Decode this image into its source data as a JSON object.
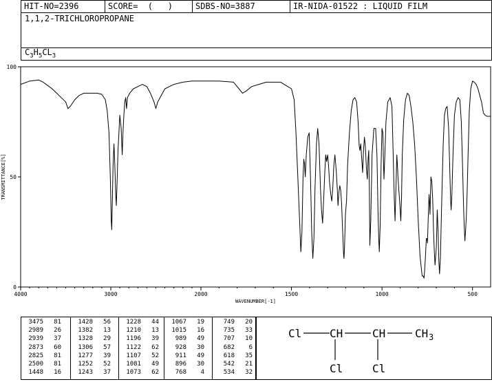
{
  "header": {
    "hit_no": "HIT-NO=2396",
    "score": "SCORE=  (   )",
    "sdbs_no": "SDBS-NO=3887",
    "ir_info": "IR-NIDA-01522 : LIQUID FILM"
  },
  "compound": {
    "name": "1,1,2-TRICHLOROPROPANE",
    "formula_parts": [
      "C",
      "3",
      "H",
      "5",
      "CL",
      "3"
    ]
  },
  "structure": {
    "atoms": [
      "Cl",
      "CH",
      "CH",
      "CH",
      "3",
      "Cl",
      "Cl"
    ]
  },
  "peak_table": {
    "columns": [
      [
        [
          "3475",
          "81"
        ],
        [
          "2989",
          "26"
        ],
        [
          "2939",
          "37"
        ],
        [
          "2873",
          "60"
        ],
        [
          "2825",
          "81"
        ],
        [
          "2500",
          "81"
        ],
        [
          "1448",
          "16"
        ]
      ],
      [
        [
          "1428",
          "56"
        ],
        [
          "1382",
          "13"
        ],
        [
          "1328",
          "29"
        ],
        [
          "1306",
          "57"
        ],
        [
          "1277",
          "39"
        ],
        [
          "1252",
          "52"
        ],
        [
          "1243",
          "37"
        ]
      ],
      [
        [
          "1228",
          "44"
        ],
        [
          "1210",
          "13"
        ],
        [
          "1196",
          "39"
        ],
        [
          "1122",
          "62"
        ],
        [
          "1107",
          "52"
        ],
        [
          "1081",
          "49"
        ],
        [
          "1073",
          "62"
        ]
      ],
      [
        [
          "1067",
          "19"
        ],
        [
          "1015",
          "16"
        ],
        [
          "989",
          "49"
        ],
        [
          "928",
          "30"
        ],
        [
          "911",
          "49"
        ],
        [
          "896",
          "30"
        ],
        [
          "768",
          "4"
        ]
      ],
      [
        [
          "749",
          "20"
        ],
        [
          "735",
          "33"
        ],
        [
          "707",
          "10"
        ],
        [
          "682",
          "6"
        ],
        [
          "618",
          "35"
        ],
        [
          "542",
          "21"
        ],
        [
          "534",
          "32"
        ]
      ]
    ]
  },
  "chart_data": {
    "type": "line",
    "title": "",
    "xlabel": "WAVENUMBER[-1]",
    "ylabel": "TRANSMITTANCE[%]",
    "xlim": [
      4000,
      400
    ],
    "ylim": [
      0,
      100
    ],
    "x_ticks": [
      4000,
      3000,
      2000,
      1500,
      1000,
      500
    ],
    "x_tick_labels": [
      "4000",
      "3000",
      "2000",
      "1500",
      "1000",
      "500"
    ],
    "y_ticks": [
      0,
      50,
      100
    ],
    "y_tick_labels": [
      "0",
      "50",
      "100"
    ],
    "grid": false,
    "series": [
      {
        "color": "#000000",
        "points": [
          [
            4000,
            92
          ],
          [
            3900,
            93.5
          ],
          [
            3800,
            94
          ],
          [
            3750,
            93
          ],
          [
            3700,
            91.5
          ],
          [
            3650,
            90
          ],
          [
            3600,
            88
          ],
          [
            3550,
            86
          ],
          [
            3500,
            84
          ],
          [
            3475,
            81
          ],
          [
            3450,
            82
          ],
          [
            3400,
            85
          ],
          [
            3350,
            87
          ],
          [
            3300,
            88
          ],
          [
            3250,
            88
          ],
          [
            3200,
            88
          ],
          [
            3150,
            88
          ],
          [
            3100,
            87.5
          ],
          [
            3060,
            85
          ],
          [
            3040,
            80
          ],
          [
            3020,
            70
          ],
          [
            3005,
            50
          ],
          [
            2995,
            30
          ],
          [
            2989,
            26
          ],
          [
            2985,
            35
          ],
          [
            2975,
            55
          ],
          [
            2965,
            65
          ],
          [
            2955,
            55
          ],
          [
            2945,
            42
          ],
          [
            2939,
            37
          ],
          [
            2932,
            45
          ],
          [
            2920,
            62
          ],
          [
            2910,
            70
          ],
          [
            2900,
            78
          ],
          [
            2885,
            72
          ],
          [
            2873,
            60
          ],
          [
            2865,
            70
          ],
          [
            2855,
            78
          ],
          [
            2845,
            84
          ],
          [
            2835,
            86
          ],
          [
            2825,
            81
          ],
          [
            2815,
            86
          ],
          [
            2790,
            88
          ],
          [
            2750,
            90
          ],
          [
            2700,
            91
          ],
          [
            2650,
            92
          ],
          [
            2600,
            91
          ],
          [
            2560,
            88
          ],
          [
            2520,
            84
          ],
          [
            2500,
            81
          ],
          [
            2480,
            84
          ],
          [
            2440,
            87
          ],
          [
            2400,
            90
          ],
          [
            2300,
            92
          ],
          [
            2200,
            93
          ],
          [
            2100,
            93.5
          ],
          [
            2000,
            93.5
          ],
          [
            1900,
            93.5
          ],
          [
            1820,
            93
          ],
          [
            1790,
            90
          ],
          [
            1770,
            88
          ],
          [
            1750,
            89
          ],
          [
            1720,
            91
          ],
          [
            1680,
            92
          ],
          [
            1640,
            93
          ],
          [
            1600,
            93
          ],
          [
            1560,
            93
          ],
          [
            1520,
            91
          ],
          [
            1500,
            90
          ],
          [
            1485,
            85
          ],
          [
            1475,
            70
          ],
          [
            1465,
            50
          ],
          [
            1455,
            30
          ],
          [
            1448,
            16
          ],
          [
            1442,
            25
          ],
          [
            1436,
            50
          ],
          [
            1432,
            58
          ],
          [
            1428,
            56
          ],
          [
            1424,
            50
          ],
          [
            1418,
            60
          ],
          [
            1410,
            68
          ],
          [
            1402,
            70
          ],
          [
            1395,
            50
          ],
          [
            1388,
            25
          ],
          [
            1382,
            13
          ],
          [
            1376,
            22
          ],
          [
            1370,
            45
          ],
          [
            1362,
            65
          ],
          [
            1355,
            72
          ],
          [
            1348,
            65
          ],
          [
            1340,
            45
          ],
          [
            1334,
            35
          ],
          [
            1328,
            29
          ],
          [
            1322,
            40
          ],
          [
            1316,
            52
          ],
          [
            1311,
            60
          ],
          [
            1306,
            57
          ],
          [
            1300,
            60
          ],
          [
            1295,
            55
          ],
          [
            1290,
            48
          ],
          [
            1283,
            42
          ],
          [
            1277,
            39
          ],
          [
            1272,
            45
          ],
          [
            1266,
            55
          ],
          [
            1260,
            60
          ],
          [
            1256,
            56
          ],
          [
            1252,
            52
          ],
          [
            1247,
            45
          ],
          [
            1243,
            37
          ],
          [
            1238,
            43
          ],
          [
            1233,
            46
          ],
          [
            1228,
            44
          ],
          [
            1223,
            38
          ],
          [
            1217,
            25
          ],
          [
            1212,
            15
          ],
          [
            1210,
            13
          ],
          [
            1207,
            18
          ],
          [
            1202,
            33
          ],
          [
            1196,
            39
          ],
          [
            1190,
            55
          ],
          [
            1180,
            70
          ],
          [
            1170,
            80
          ],
          [
            1160,
            85
          ],
          [
            1150,
            86
          ],
          [
            1140,
            84
          ],
          [
            1132,
            75
          ],
          [
            1126,
            64
          ],
          [
            1122,
            62
          ],
          [
            1117,
            65
          ],
          [
            1112,
            58
          ],
          [
            1107,
            52
          ],
          [
            1102,
            62
          ],
          [
            1097,
            68
          ],
          [
            1092,
            64
          ],
          [
            1086,
            54
          ],
          [
            1081,
            49
          ],
          [
            1077,
            58
          ],
          [
            1073,
            62
          ],
          [
            1070,
            45
          ],
          [
            1067,
            19
          ],
          [
            1062,
            30
          ],
          [
            1055,
            60
          ],
          [
            1045,
            72
          ],
          [
            1035,
            72
          ],
          [
            1028,
            60
          ],
          [
            1022,
            35
          ],
          [
            1018,
            22
          ],
          [
            1015,
            16
          ],
          [
            1010,
            28
          ],
          [
            1005,
            55
          ],
          [
            1000,
            72
          ],
          [
            995,
            70
          ],
          [
            992,
            58
          ],
          [
            989,
            49
          ],
          [
            985,
            58
          ],
          [
            978,
            75
          ],
          [
            968,
            84
          ],
          [
            955,
            86
          ],
          [
            945,
            82
          ],
          [
            938,
            60
          ],
          [
            932,
            40
          ],
          [
            928,
            30
          ],
          [
            923,
            45
          ],
          [
            918,
            60
          ],
          [
            914,
            54
          ],
          [
            911,
            49
          ],
          [
            907,
            44
          ],
          [
            903,
            40
          ],
          [
            900,
            36
          ],
          [
            896,
            30
          ],
          [
            892,
            40
          ],
          [
            888,
            60
          ],
          [
            880,
            76
          ],
          [
            870,
            85
          ],
          [
            860,
            88
          ],
          [
            850,
            87
          ],
          [
            840,
            82
          ],
          [
            830,
            75
          ],
          [
            820,
            65
          ],
          [
            810,
            50
          ],
          [
            800,
            30
          ],
          [
            790,
            14
          ],
          [
            782,
            8
          ],
          [
            778,
            5
          ],
          [
            772,
            5
          ],
          [
            768,
            4
          ],
          [
            764,
            8
          ],
          [
            760,
            14
          ],
          [
            755,
            22
          ],
          [
            751,
            22
          ],
          [
            749,
            20
          ],
          [
            745,
            30
          ],
          [
            740,
            42
          ],
          [
            737,
            38
          ],
          [
            735,
            33
          ],
          [
            730,
            50
          ],
          [
            725,
            48
          ],
          [
            720,
            40
          ],
          [
            715,
            25
          ],
          [
            711,
            16
          ],
          [
            707,
            10
          ],
          [
            700,
            18
          ],
          [
            695,
            35
          ],
          [
            690,
            25
          ],
          [
            686,
            12
          ],
          [
            682,
            6
          ],
          [
            677,
            14
          ],
          [
            670,
            40
          ],
          [
            662,
            65
          ],
          [
            655,
            78
          ],
          [
            648,
            81
          ],
          [
            640,
            82
          ],
          [
            632,
            72
          ],
          [
            626,
            55
          ],
          [
            621,
            40
          ],
          [
            618,
            35
          ],
          [
            614,
            42
          ],
          [
            608,
            60
          ],
          [
            600,
            78
          ],
          [
            590,
            84
          ],
          [
            580,
            86
          ],
          [
            570,
            85
          ],
          [
            562,
            75
          ],
          [
            555,
            55
          ],
          [
            549,
            35
          ],
          [
            546,
            28
          ],
          [
            542,
            21
          ],
          [
            538,
            26
          ],
          [
            534,
            32
          ],
          [
            530,
            42
          ],
          [
            524,
            62
          ],
          [
            518,
            80
          ],
          [
            510,
            90
          ],
          [
            500,
            93.5
          ],
          [
            490,
            93
          ],
          [
            480,
            92
          ],
          [
            470,
            90
          ],
          [
            460,
            87
          ],
          [
            450,
            84
          ],
          [
            440,
            79
          ],
          [
            430,
            78
          ],
          [
            420,
            77.5
          ],
          [
            410,
            77.5
          ],
          [
            400,
            77.5
          ]
        ]
      }
    ]
  }
}
